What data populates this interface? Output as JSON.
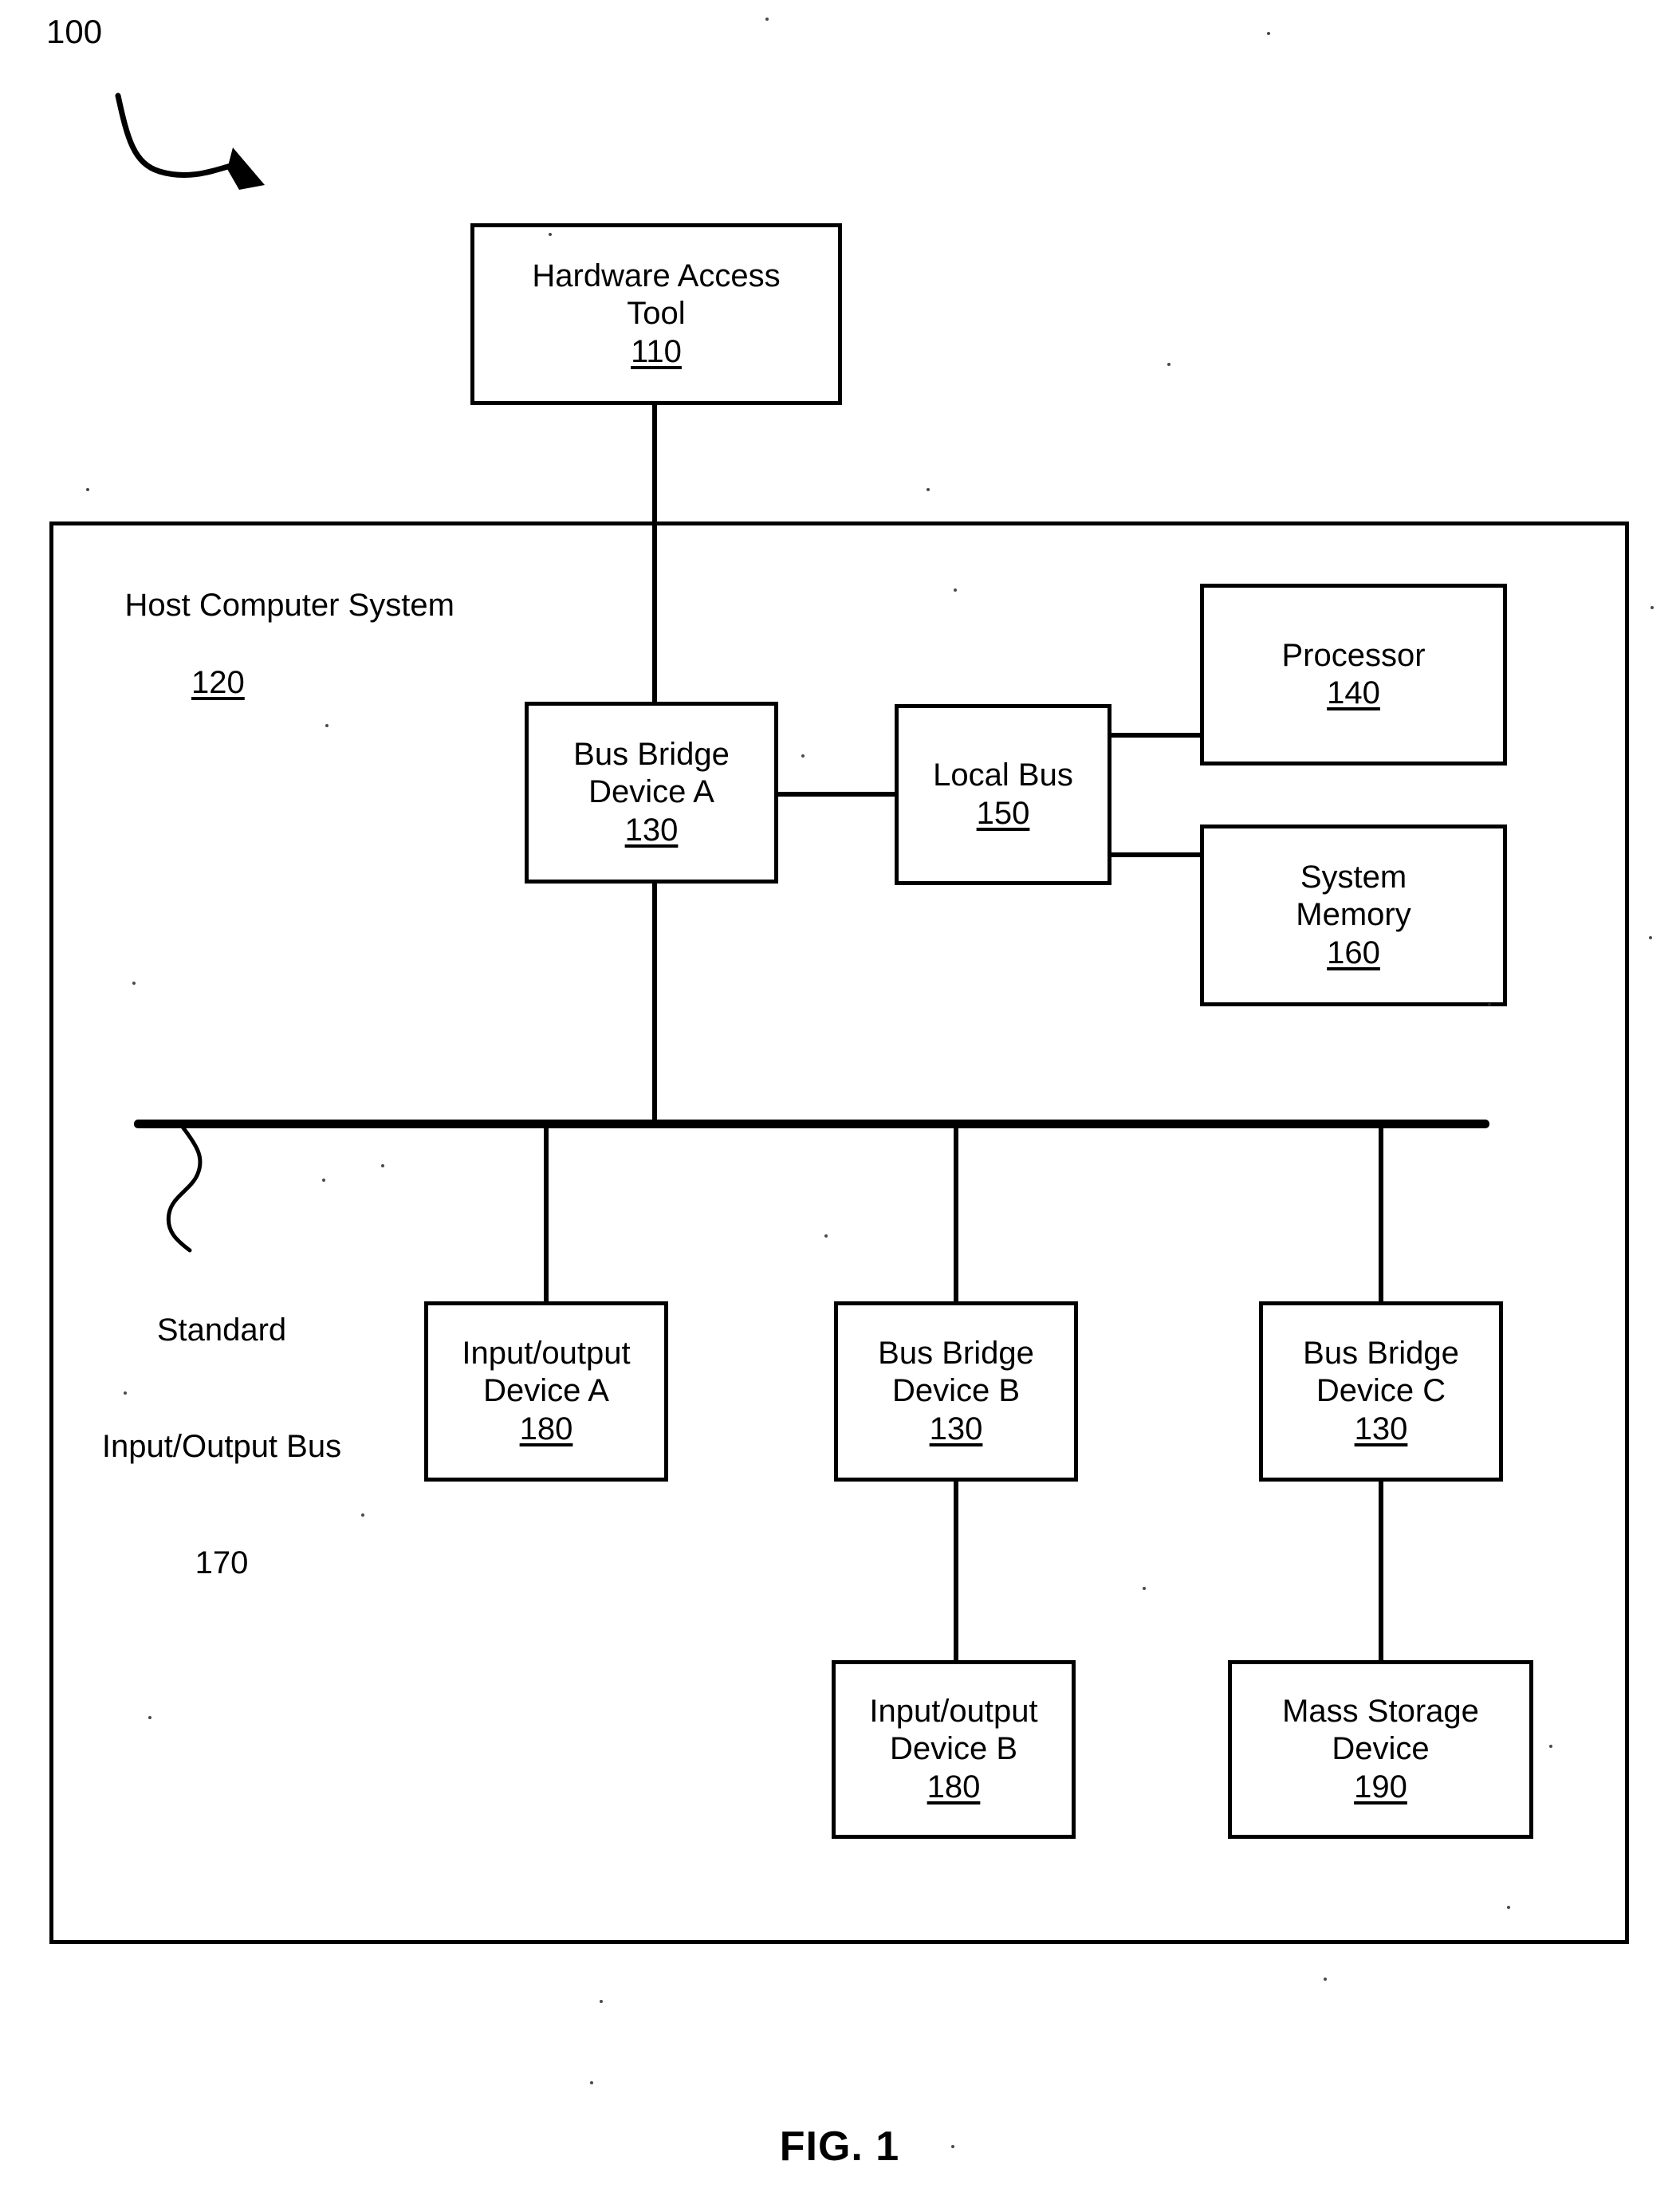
{
  "figure": {
    "caption": "FIG. 1",
    "system_tag": "100"
  },
  "nodes": {
    "hardware_access_tool": {
      "line1": "Hardware Access",
      "line2": "Tool",
      "ref": "110"
    },
    "host_computer_system": {
      "title": "Host Computer System",
      "ref": "120"
    },
    "bus_bridge_a": {
      "line1": "Bus Bridge",
      "line2": "Device A",
      "ref": "130"
    },
    "local_bus": {
      "line1": "Local Bus",
      "ref": "150"
    },
    "processor": {
      "line1": "Processor",
      "ref": "140"
    },
    "system_memory": {
      "line1": "System",
      "line2": "Memory",
      "ref": "160"
    },
    "standard_io_bus": {
      "line1": "Standard",
      "line2": "Input/Output Bus",
      "ref": "170"
    },
    "io_device_a": {
      "line1": "Input/output",
      "line2": "Device A",
      "ref": "180"
    },
    "bus_bridge_b": {
      "line1": "Bus Bridge",
      "line2": "Device B",
      "ref": "130"
    },
    "bus_bridge_c": {
      "line1": "Bus Bridge",
      "line2": "Device C",
      "ref": "130"
    },
    "io_device_b": {
      "line1": "Input/output",
      "line2": "Device B",
      "ref": "180"
    },
    "mass_storage_device": {
      "line1": "Mass Storage",
      "line2": "Device",
      "ref": "190"
    }
  },
  "colors": {
    "ink": "#000000",
    "paper": "#ffffff"
  }
}
